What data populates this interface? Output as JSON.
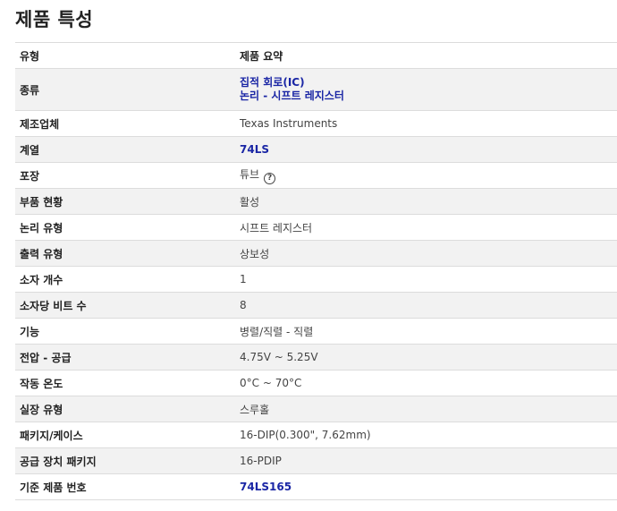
{
  "page_title": "제품 특성",
  "table": {
    "header": {
      "label": "유형",
      "value": "제품 요약"
    },
    "rows": [
      {
        "label": "종류",
        "values": [
          "집적 회로(IC)",
          "논리 - 시프트 레지스터"
        ],
        "link": true
      },
      {
        "label": "제조업체",
        "value": "Texas Instruments"
      },
      {
        "label": "계열",
        "value": "74LS",
        "link": true
      },
      {
        "label": "포장",
        "value": "튜브",
        "help_icon": "?"
      },
      {
        "label": "부품 현황",
        "value": "활성"
      },
      {
        "label": "논리 유형",
        "value": "시프트 레지스터"
      },
      {
        "label": "출력 유형",
        "value": "상보성"
      },
      {
        "label": "소자 개수",
        "value": "1"
      },
      {
        "label": "소자당 비트 수",
        "value": "8"
      },
      {
        "label": "기능",
        "value": "병렬/직렬 - 직렬"
      },
      {
        "label": "전압 - 공급",
        "value": "4.75V ~ 5.25V"
      },
      {
        "label": "작동 온도",
        "value": "0°C ~ 70°C"
      },
      {
        "label": "실장 유형",
        "value": "스루홀"
      },
      {
        "label": "패키지/케이스",
        "value": "16-DIP(0.300\", 7.62mm)"
      },
      {
        "label": "공급 장치 패키지",
        "value": "16-PDIP"
      },
      {
        "label": "기준 제품 번호",
        "value": "74LS165",
        "link": true
      }
    ]
  },
  "colors": {
    "link": "#1a26a5",
    "row_shade": "#f2f2f2",
    "border": "#dcdcdc"
  }
}
